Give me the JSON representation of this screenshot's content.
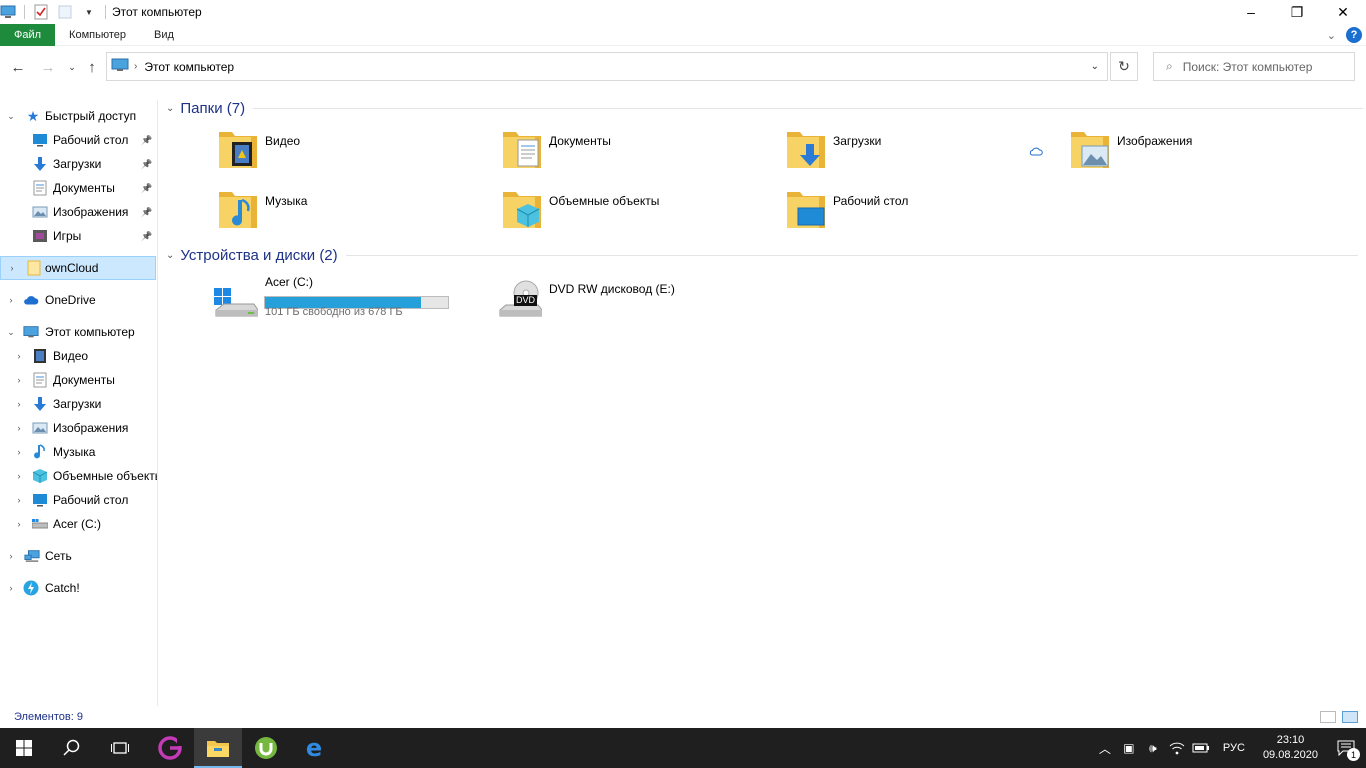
{
  "window": {
    "title": "Этот компьютер",
    "controls": {
      "minimize": "–",
      "maximize": "❐",
      "close": "✕"
    }
  },
  "ribbon": {
    "tabs": [
      "Файл",
      "Компьютер",
      "Вид"
    ],
    "help": "?"
  },
  "navigation": {
    "path": "Этот компьютер",
    "search_placeholder": "Поиск: Этот компьютер"
  },
  "sidebar": {
    "quick_access": {
      "label": "Быстрый доступ",
      "items": [
        {
          "label": "Рабочий стол",
          "icon": "desktop-icon"
        },
        {
          "label": "Загрузки",
          "icon": "downloads-icon"
        },
        {
          "label": "Документы",
          "icon": "documents-icon"
        },
        {
          "label": "Изображения",
          "icon": "pictures-icon"
        },
        {
          "label": "Игры",
          "icon": "games-icon"
        }
      ]
    },
    "owncloud": "ownCloud",
    "onedrive": "OneDrive",
    "this_pc": {
      "label": "Этот компьютер",
      "items": [
        {
          "label": "Видео",
          "icon": "video-icon"
        },
        {
          "label": "Документы",
          "icon": "documents-icon"
        },
        {
          "label": "Загрузки",
          "icon": "downloads-icon"
        },
        {
          "label": "Изображения",
          "icon": "pictures-icon"
        },
        {
          "label": "Музыка",
          "icon": "music-icon"
        },
        {
          "label": "Объемные объекты",
          "icon": "3d-objects-icon"
        },
        {
          "label": "Рабочий стол",
          "icon": "desktop-icon"
        },
        {
          "label": "Acer (C:)",
          "icon": "drive-icon"
        }
      ]
    },
    "network": "Сеть",
    "catch": "Catch!"
  },
  "main": {
    "folders_header": "Папки (7)",
    "folders": [
      {
        "label": "Видео",
        "icon": "video-folder-icon"
      },
      {
        "label": "Документы",
        "icon": "documents-folder-icon"
      },
      {
        "label": "Загрузки",
        "icon": "downloads-folder-icon"
      },
      {
        "label": "Изображения",
        "icon": "pictures-folder-icon"
      },
      {
        "label": "Музыка",
        "icon": "music-folder-icon"
      },
      {
        "label": "Объемные объекты",
        "icon": "3d-objects-folder-icon"
      },
      {
        "label": "Рабочий стол",
        "icon": "desktop-folder-icon"
      }
    ],
    "devices_header": "Устройства и диски (2)",
    "drives": [
      {
        "label": "Acer (C:)",
        "free_text": "101 ГБ свободно из 678 ГБ",
        "used_fraction": 0.851
      },
      {
        "label": "DVD RW дисковод (E:)",
        "badge": "DVD"
      }
    ]
  },
  "status_bar": {
    "count": "Элементов: 9"
  },
  "taskbar": {
    "language": "РУС",
    "time": "23:10",
    "date": "09.08.2020",
    "notifications": "1"
  },
  "colors": {
    "file_tab": "#1e8a3c",
    "accent_blue": "#1e3287",
    "drive_fill": "#26a0da",
    "folder_yellow": "#f7c94a",
    "selection": "#cce8ff"
  }
}
